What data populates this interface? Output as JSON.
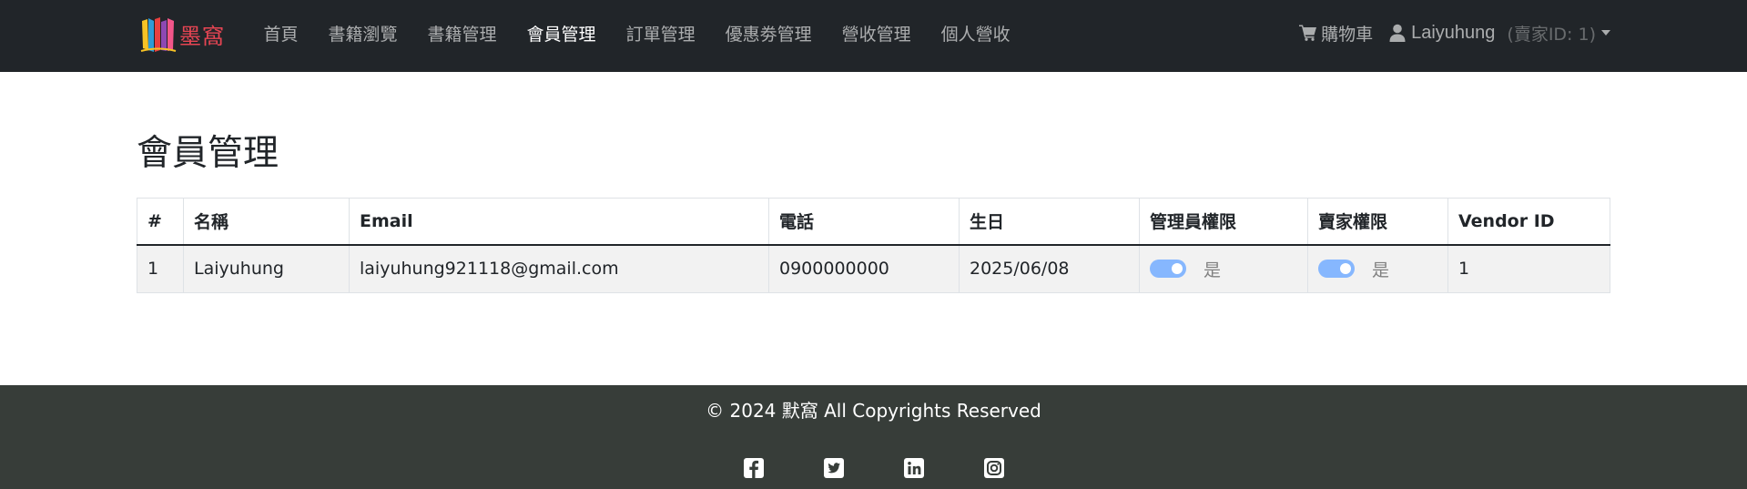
{
  "brand": {
    "name": "墨窩"
  },
  "nav": {
    "links": [
      {
        "label": "首頁"
      },
      {
        "label": "書籍瀏覽"
      },
      {
        "label": "書籍管理"
      },
      {
        "label": "會員管理"
      },
      {
        "label": "訂單管理"
      },
      {
        "label": "優惠劵管理"
      },
      {
        "label": "營收管理"
      },
      {
        "label": "個人營收"
      }
    ],
    "active_index": 3,
    "cart_label": "購物車",
    "user_name": "Laiyuhung",
    "vendor_tag": "(賣家ID: 1)"
  },
  "page": {
    "title": "會員管理"
  },
  "table": {
    "headers": [
      "#",
      "名稱",
      "Email",
      "電話",
      "生日",
      "管理員權限",
      "賣家權限",
      "Vendor ID"
    ],
    "rows": [
      {
        "id": "1",
        "name": "Laiyuhung",
        "email": "laiyuhung921118@gmail.com",
        "phone": "0900000000",
        "birthday": "2025/06/08",
        "admin": {
          "enabled": true,
          "label": "是"
        },
        "seller": {
          "enabled": true,
          "label": "是"
        },
        "vendor_id": "1"
      }
    ]
  },
  "footer": {
    "copyright": "© 2024 默窩 All Copyrights Reserved",
    "socials": [
      "facebook-icon",
      "twitter-icon",
      "linkedin-icon",
      "instagram-icon"
    ]
  },
  "colors": {
    "navbar_bg": "#212529",
    "footer_bg": "#373d39",
    "brand_text": "#e64553",
    "switch_on": "#86b7fe",
    "row_bg": "#f2f2f2"
  }
}
